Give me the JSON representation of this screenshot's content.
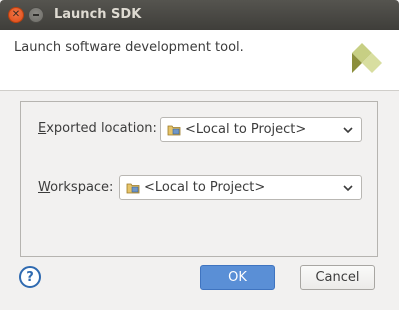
{
  "window": {
    "title": "Launch SDK"
  },
  "header": {
    "message": "Launch software development tool."
  },
  "fields": {
    "exported_location": {
      "label_mnemonic": "E",
      "label_rest": "xported location:",
      "value": "<Local to Project>"
    },
    "workspace": {
      "label_mnemonic": "W",
      "label_rest": "orkspace:",
      "value": "<Local to Project>"
    }
  },
  "buttons": {
    "help": "?",
    "ok": "OK",
    "cancel": "Cancel"
  }
}
